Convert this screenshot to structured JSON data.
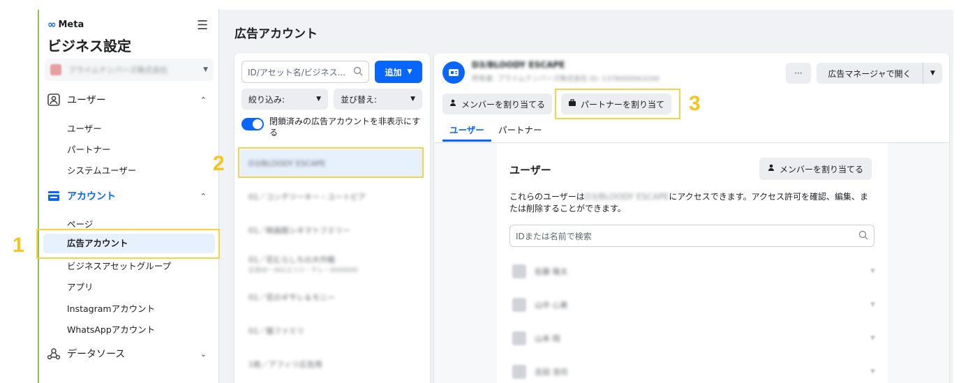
{
  "sidebar": {
    "logo": "Meta",
    "title": "ビジネス設定",
    "business_name": "プライムナンバーズ株式会社",
    "sections": [
      {
        "label": "ユーザー",
        "items": [
          "ユーザー",
          "パートナー",
          "システムユーザー"
        ]
      },
      {
        "label": "アカウント",
        "items": [
          "ページ",
          "広告アカウント",
          "ビジネスアセットグループ",
          "アプリ",
          "Instagramアカウント",
          "WhatsAppアカウント"
        ]
      },
      {
        "label": "データソース"
      }
    ]
  },
  "main": {
    "page_title": "広告アカウント"
  },
  "list_panel": {
    "search_placeholder": "ID/アセット名/ビジネス...",
    "add_label": "追加",
    "filter_label": "絞り込み:",
    "sort_label": "並び替え:",
    "toggle_label": "閉鎖済みの広告アカウントを非表示にする",
    "toggle_on": true,
    "accounts": [
      {
        "name": "D3/BLOODY ESCAPE"
      },
      {
        "name": "01／コンテツーキー・ユートピア"
      },
      {
        "name": "01／映画館シネマトフミリー"
      },
      {
        "name": "01／花むらしちの大作戦",
        "sub": "広告ID・001エリジ・テレ・0000000"
      },
      {
        "name": "01／花のギサレ＆モニー"
      },
      {
        "name": "01／猫ファミリ"
      },
      {
        "name": "1枚／アフィリ広告用"
      }
    ]
  },
  "detail": {
    "account_name": "D3/BLOODY ESCAPE",
    "account_sub": "所有者: プライムナンバーズ株式会社  ID: 1378000063200",
    "more_label": "···",
    "open_label": "広告マネージャで開く",
    "assign_member": "メンバーを割り当てる",
    "assign_partner": "パートナーを割り当て",
    "tabs": [
      "ユーザー",
      "パートナー"
    ],
    "users_heading": "ユーザー",
    "assign_member_2": "メンバーを割り当てる",
    "desc_before": "これらのユーザーは",
    "desc_blur": "D3/BLOODY ESCAPE",
    "desc_after": "にアクセスできます。アクセス許可を確認、編集、または削除することができます。",
    "search_placeholder": "IDまたは名前で検索",
    "users": [
      "佐藤 隆太",
      "山中 心美",
      "山本 翔",
      "吉田 浩司"
    ]
  },
  "annotations": [
    "1",
    "2",
    "3"
  ],
  "colors": {
    "accent": "#0866ff",
    "highlight": "#f5d24a",
    "number": "#f5c518"
  }
}
